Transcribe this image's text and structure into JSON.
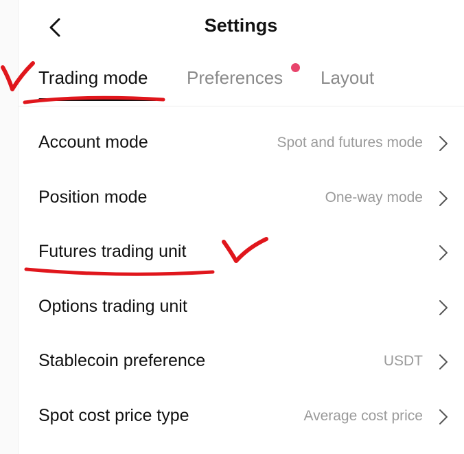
{
  "header": {
    "title": "Settings",
    "back_icon": "chevron-left-icon"
  },
  "tabs": [
    {
      "label": "Trading mode",
      "active": true
    },
    {
      "label": "Preferences",
      "active": false,
      "has_notification_dot": true
    },
    {
      "label": "Layout",
      "active": false
    }
  ],
  "colors": {
    "notification_dot": "#e8456c",
    "annotation_red": "#e0161c",
    "value_text": "#9a9a9a"
  },
  "settings": [
    {
      "label": "Account mode",
      "value": "Spot and futures mode"
    },
    {
      "label": "Position mode",
      "value": "One-way mode"
    },
    {
      "label": "Futures trading unit",
      "value": ""
    },
    {
      "label": "Options trading unit",
      "value": ""
    },
    {
      "label": "Stablecoin preference",
      "value": "USDT"
    },
    {
      "label": "Spot cost price type",
      "value": "Average cost price"
    }
  ]
}
